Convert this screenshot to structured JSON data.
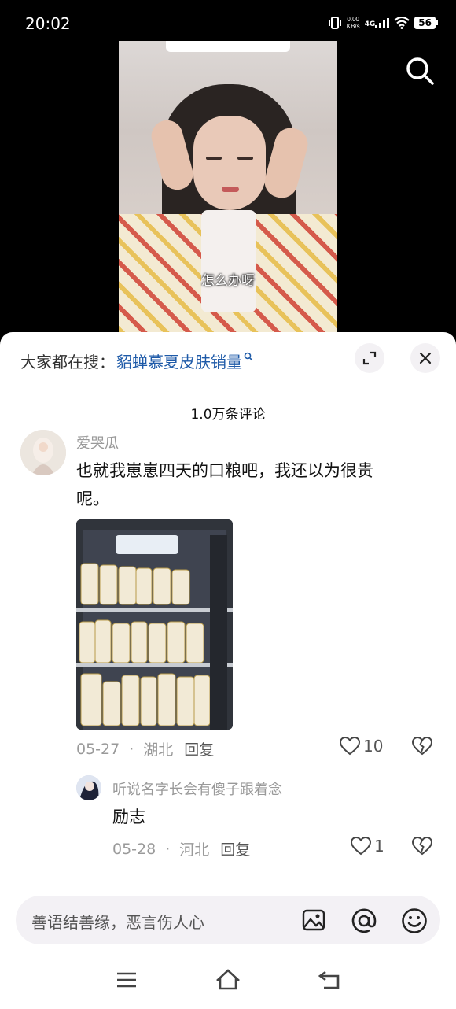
{
  "status": {
    "time": "20:02",
    "net_speed_value": "0.00",
    "net_speed_unit": "KB/s",
    "network": "4G",
    "battery": "56"
  },
  "video": {
    "subtitle": "怎么办呀"
  },
  "sheet": {
    "hot_prefix": "大家都在搜：",
    "hot_query": "貂蝉慕夏皮肤销量",
    "comment_count": "1.0万条评论"
  },
  "comments": [
    {
      "user": "爱哭瓜",
      "text_line1": "也就我崽崽四天的口粮吧，我还以为很贵",
      "text_line2": "呢。",
      "date": "05-27",
      "location": "湖北",
      "reply_label": "回复",
      "likes": "10",
      "reply": {
        "user": "听说名字长会有傻子跟着念",
        "text": "励志",
        "date": "05-28",
        "location": "河北",
        "reply_label": "回复",
        "likes": "1"
      }
    }
  ],
  "input": {
    "placeholder": "善语结善缘，恶言伤人心"
  },
  "icons": [
    "search-icon",
    "expand-icon",
    "close-icon",
    "heart-icon",
    "broken-heart-icon",
    "image-icon",
    "at-icon",
    "emoji-icon",
    "menu-icon",
    "home-icon",
    "back-icon"
  ],
  "colors": {
    "accent_link": "#1e5aa8",
    "muted": "#9a9a9a",
    "sheet_bg": "#ffffff",
    "input_bg": "#f3f1f5"
  }
}
